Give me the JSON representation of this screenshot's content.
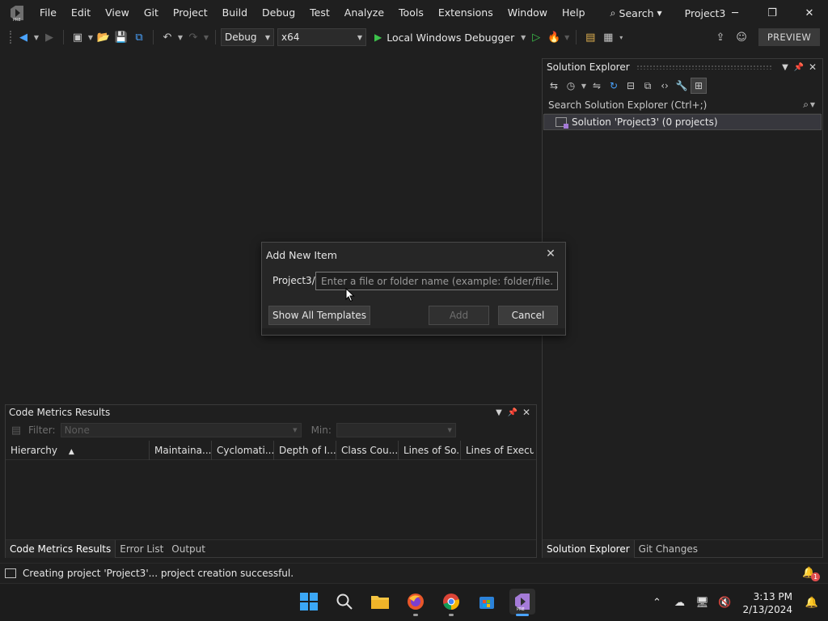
{
  "titlebar": {
    "menu": [
      "File",
      "Edit",
      "View",
      "Git",
      "Project",
      "Build",
      "Debug",
      "Test",
      "Analyze",
      "Tools",
      "Extensions",
      "Window",
      "Help"
    ],
    "search_label": "Search",
    "project_title": "Project3"
  },
  "toolbar": {
    "config": "Debug",
    "platform": "x64",
    "run_label": "Local Windows Debugger",
    "preview_label": "PREVIEW"
  },
  "solution_explorer": {
    "title": "Solution Explorer",
    "search_placeholder": "Search Solution Explorer (Ctrl+;)",
    "root_item": "Solution 'Project3' (0 projects)",
    "tabs": [
      "Solution Explorer",
      "Git Changes"
    ]
  },
  "code_metrics": {
    "title": "Code Metrics Results",
    "filter_label": "Filter:",
    "filter_value": "None",
    "min_label": "Min:",
    "columns": [
      "Hierarchy",
      "Maintaina...",
      "Cyclomati...",
      "Depth of I...",
      "Class Cou...",
      "Lines of So...",
      "Lines of Execu..."
    ],
    "tabs": [
      "Code Metrics Results",
      "Error List",
      "Output"
    ]
  },
  "dialog": {
    "title": "Add New Item",
    "prefix": "Project3/",
    "input_placeholder": "Enter a file or folder name (example: folder/file.cs)",
    "show_templates_label": "Show All Templates",
    "add_label": "Add",
    "cancel_label": "Cancel"
  },
  "statusbar": {
    "message": "Creating project 'Project3'... project creation successful.",
    "notification_count": "1"
  },
  "taskbar": {
    "time": "3:13 PM",
    "date": "2/13/2024"
  },
  "colors": {
    "accent": "#4aa3ff",
    "run_green": "#3dc24b",
    "vs_purple": "#a57bd8"
  }
}
